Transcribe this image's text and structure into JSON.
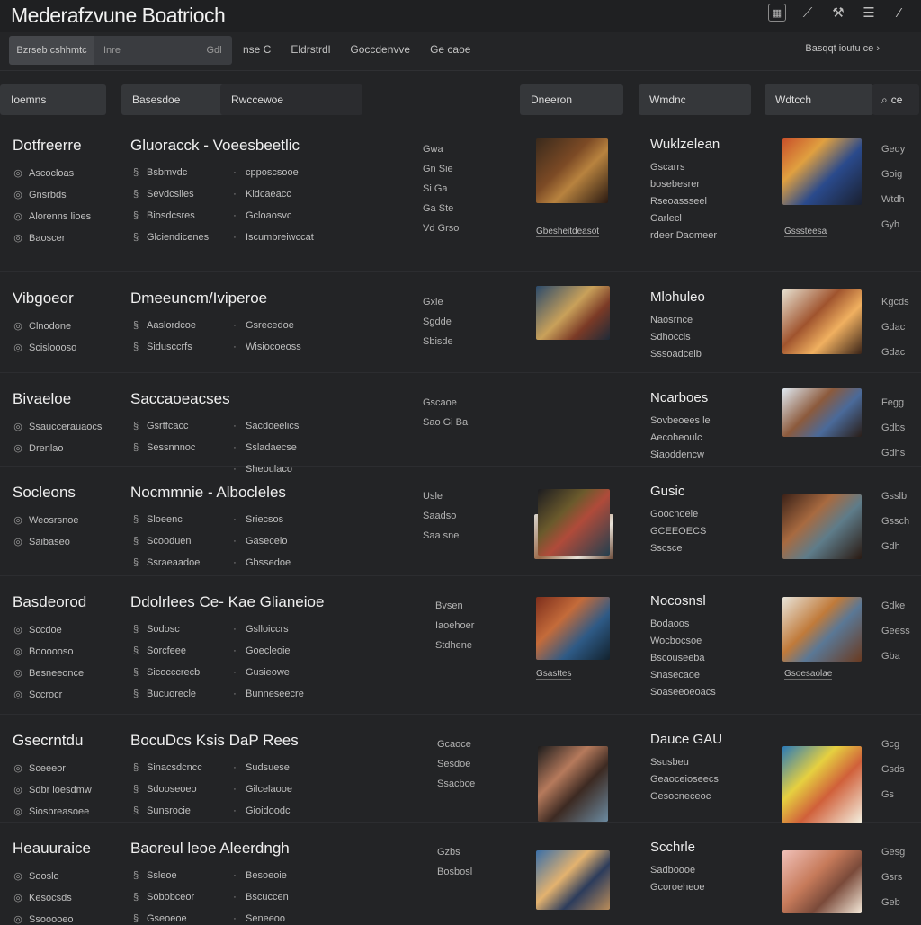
{
  "app": {
    "title": "Mederafzvune Boatrioch"
  },
  "window": {
    "icons": [
      "grid-icon",
      "brush-icon",
      "tools-icon",
      "menu-icon",
      "minimize-icon"
    ]
  },
  "toolbar": {
    "search_scope": "Bzrseb cshhmtc",
    "search_placeholder": "Inre",
    "search_suffix": "Gdl",
    "links": [
      "nse C",
      "Eldrstrdl",
      "Goccdenvve",
      "Ge caoe"
    ],
    "right_label": "Basqqt ioutu ce"
  },
  "header": {
    "col1": "Ioemns",
    "col2": "Basesdoe",
    "col3": "Rwccewoe",
    "col4": "Dneeron",
    "col5": "Wmdnc",
    "col6": "Wdtcch",
    "col7": "ce"
  },
  "rows": [
    {
      "category": "Dotfreerre",
      "cat_items": [
        "Ascocloas",
        "Gnsrbds",
        "Alorenns lioes",
        "Baoscer"
      ],
      "title": "Gluoracck - Voeesbeetlic",
      "left_items": [
        "Bsbmvdc",
        "Sevdcslles",
        "Biosdcsres",
        "Glciendicenes"
      ],
      "right_items": [
        "cpposcsooe",
        "Kidcaeacc",
        "Gcloaosvc",
        "Iscumbreiwccat"
      ],
      "meta": [
        "Gwa",
        "Gn Sie",
        "Si Ga",
        "Ga Ste",
        "Vd Grso"
      ],
      "thumb_caption": "Gbesheitdeasot",
      "desc_title": "Wuklzelean",
      "desc": [
        "Gscarrs",
        "bosebesrer",
        "Rseoassseel",
        "Garlecl",
        "rdeer Daomeer"
      ],
      "thumb2_caption": "Gsssteesa",
      "far": [
        "Gedy",
        "Goig",
        "Wtdh",
        "Gyh"
      ]
    },
    {
      "category": "Vibgoeor",
      "cat_items": [
        "Clnodone",
        "Scisloooso"
      ],
      "title": "Dmeeuncm/Iviperoe",
      "left_items": [
        "Aaslordcoe",
        "Sidusccrfs"
      ],
      "right_items": [
        "Gsrecedoe",
        "Wisiocoeoss"
      ],
      "meta": [
        "Gxle",
        "Sgdde",
        "Sbisde"
      ],
      "desc_title": "Mlohuleo",
      "desc": [
        "Naosrnce",
        "Sdhoccis",
        "Sssoadcelb"
      ],
      "far": [
        "Kgcds",
        "Gdac",
        "Gdac"
      ]
    },
    {
      "category": "Bivaeloe",
      "cat_items": [
        "Ssauccerauaocs",
        "Drenlao"
      ],
      "title": "Saccaoeacses",
      "left_items": [
        "Gsrtfcacc",
        "Sessnnnoc"
      ],
      "right_items": [
        "Sacdoeelics",
        "Ssladaecse",
        "Sheoulaco"
      ],
      "meta": [
        "Gscaoe",
        "Sao Gi Ba"
      ],
      "desc_title": "Ncarboes",
      "desc": [
        "Sovbeoees le",
        "Aecoheoulc",
        "Siaoddencw"
      ],
      "far": [
        "Fegg",
        "Gdbs",
        "Gdhs"
      ]
    },
    {
      "category": "Socleons",
      "cat_items": [
        "Weosrsnoe",
        "Saibaseo"
      ],
      "title": "Nocmmnie - Albocleles",
      "left_items": [
        "Sloeenc",
        "Scooduen",
        "Ssraeaadoe"
      ],
      "right_items": [
        "Sriecsos",
        "Gasecelo",
        "Gbssedoe"
      ],
      "meta": [
        "Usle",
        "Saadso",
        "Saa sne"
      ],
      "desc_title": "Gusic",
      "desc": [
        "Goocnoeie",
        "GCEEOECS",
        "Sscsce"
      ],
      "far": [
        "Gsslb",
        "Gssch",
        "Gdh"
      ]
    },
    {
      "category": "Basdeorod",
      "cat_items": [
        "Sccdoe",
        "Boooooso",
        "Besneeonce",
        "Sccrocr"
      ],
      "title": "Ddolrlees Ce- Kae Glianeioe",
      "left_items": [
        "Sodosc",
        "Sorcfeee",
        "Sicocccrecb",
        "Bucuorecle"
      ],
      "right_items": [
        "Gslloiccrs",
        "Goecleoie",
        "Gusieowe",
        "Bunneseecre"
      ],
      "meta": [
        "Bvsen",
        "Iaoehoer",
        "Stdhene"
      ],
      "thumb_caption": "Gsasttes",
      "desc_title": "Nocosnsl",
      "desc": [
        "Bodaoos",
        "Wocbocsoe",
        "Bscouseeba",
        "Snasecaoe",
        "Soaseeoeoacs"
      ],
      "thumb2_caption": "Gsoesaolae",
      "far": [
        "Gdke",
        "Geess",
        "Gba"
      ]
    },
    {
      "category": "Gsecrntdu",
      "cat_items": [
        "Sceeeor",
        "Sdbr loesdmw",
        "Siosbreasoee"
      ],
      "title": "BocuDcs Ksis DaP Rees",
      "left_items": [
        "Sinacsdcncc",
        "Sdooseoeo",
        "Sunsrocie"
      ],
      "right_items": [
        "Sudsuese",
        "Gilcelaooe",
        "Gioidoodc"
      ],
      "meta": [
        "Gcaoce",
        "Sesdoe",
        "Ssacbce"
      ],
      "desc_title": "Dauce GAU",
      "desc": [
        "Ssusbeu",
        "Geaoceioseecs",
        "Gesocneceoc"
      ],
      "far": [
        "Gcg",
        "Gsds",
        "Gs"
      ]
    },
    {
      "category": "Heauuraice",
      "cat_items": [
        "Sooslo",
        "Kesocsds",
        "Ssooooeo"
      ],
      "title": "Baoreul leoe Aleerdngh",
      "left_items": [
        "Ssleoe",
        "Sobobceor",
        "Gseoeoe"
      ],
      "right_items": [
        "Besoeoie",
        "Bscuccen",
        "Seneeoo"
      ],
      "meta": [
        "Gzbs",
        "Bosbosl"
      ],
      "desc_title": "Scchrle",
      "desc": [
        "Sadboooe",
        "Gcoroeheoe"
      ],
      "far": [
        "Gesg",
        "Gsrs",
        "Geb"
      ]
    }
  ]
}
